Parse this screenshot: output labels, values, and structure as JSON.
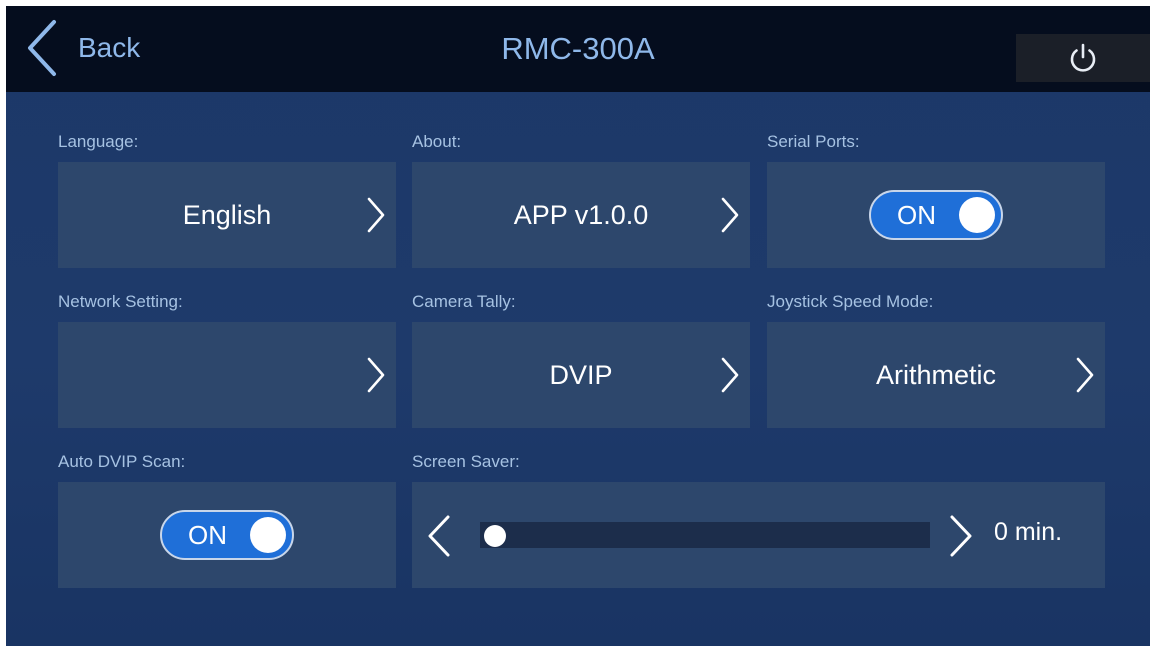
{
  "header": {
    "back_label": "Back",
    "title": "RMC-300A"
  },
  "settings": {
    "language": {
      "label": "Language:",
      "value": "English"
    },
    "about": {
      "label": "About:",
      "value": "APP v1.0.0"
    },
    "serial_ports": {
      "label": "Serial Ports:",
      "toggle_text": "ON"
    },
    "network": {
      "label": "Network Setting:",
      "value": ""
    },
    "camera_tally": {
      "label": "Camera Tally:",
      "value": "DVIP"
    },
    "joystick_speed": {
      "label": "Joystick Speed Mode:",
      "value": "Arithmetic"
    },
    "auto_dvip": {
      "label": "Auto DVIP Scan:",
      "toggle_text": "ON"
    },
    "screen_saver": {
      "label": "Screen Saver:",
      "value_text": "0 min.",
      "level": 0
    }
  },
  "colors": {
    "background": "#1e3a6b",
    "topbar": "#050d1e",
    "tile": "#2d476c",
    "accent_text": "#8fb8ea",
    "toggle_on": "#1f6fd8"
  },
  "icons": {
    "back": "chevron-left-icon",
    "power": "power-icon",
    "row_chevron": "chevron-right-icon"
  }
}
